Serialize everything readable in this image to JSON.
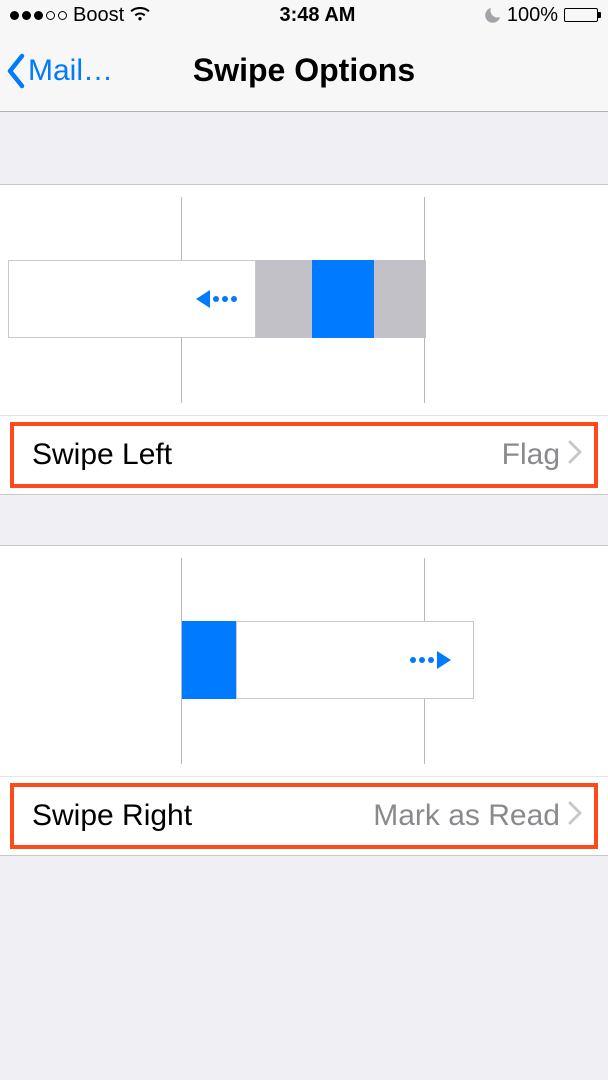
{
  "status_bar": {
    "carrier": "Boost",
    "time": "3:48 AM",
    "battery_text": "100%",
    "signal_filled": 3,
    "signal_total": 5
  },
  "nav": {
    "back_label": "Mail…",
    "title": "Swipe Options"
  },
  "rows": {
    "swipe_left": {
      "label": "Swipe Left",
      "value": "Flag"
    },
    "swipe_right": {
      "label": "Swipe Right",
      "value": "Mark as Read"
    }
  }
}
